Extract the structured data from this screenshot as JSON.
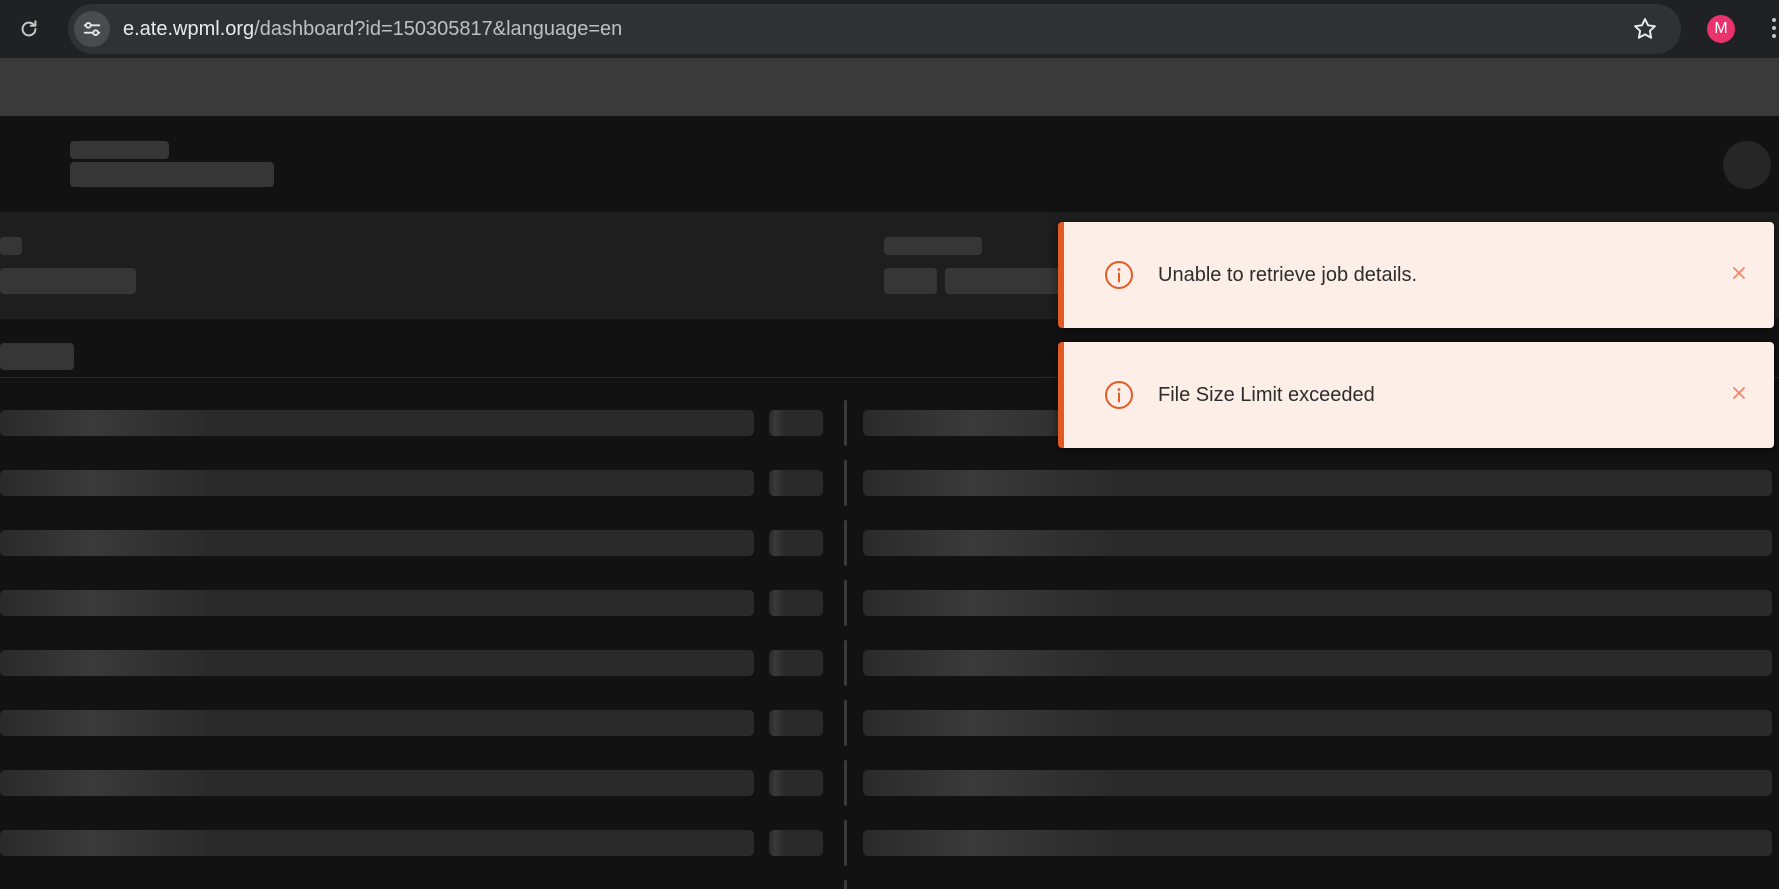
{
  "browser": {
    "url_host": "e.ate.wpml.org",
    "url_path": "/dashboard?id=150305817&language=en",
    "profile_initial": "M",
    "profile_color": "#e8336c",
    "icons": [
      "reload-icon",
      "site-info-icon",
      "bookmark-star-icon",
      "kebab-menu-icon"
    ]
  },
  "page": {
    "state": "loading-skeleton",
    "skeleton_rows": 8
  },
  "toasts": [
    {
      "type": "error",
      "icon": "info-icon",
      "message": "Unable to retrieve job details.",
      "close_icon": "close-icon"
    },
    {
      "type": "error",
      "icon": "info-icon",
      "message": "File Size Limit exceeded",
      "close_icon": "close-icon"
    }
  ],
  "colors": {
    "toast_background": "#fdeee8",
    "toast_accent": "#e35a25",
    "page_background": "#121212",
    "skeleton": "#2b2b2b"
  }
}
